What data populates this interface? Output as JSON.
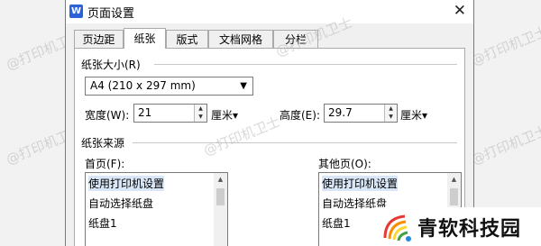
{
  "window": {
    "title": "页面设置",
    "close_icon": "✕"
  },
  "tabs": [
    {
      "label": "页边距",
      "active": false
    },
    {
      "label": "纸张",
      "active": true
    },
    {
      "label": "版式",
      "active": false
    },
    {
      "label": "文档网格",
      "active": false
    },
    {
      "label": "分栏",
      "active": false
    }
  ],
  "paper_size": {
    "section_label": "纸张大小(R)",
    "selected": "A4 (210 x 297 mm)",
    "width_label": "宽度(W):",
    "width_value": "21",
    "width_unit": "厘米▾",
    "height_label": "高度(E):",
    "height_value": "29.7",
    "height_unit": "厘米▾"
  },
  "paper_source": {
    "section_label": "纸张来源",
    "first_page_label": "首页(F):",
    "first_page_items": [
      "使用打印机设置",
      "自动选择纸盘",
      "纸盘1"
    ],
    "other_pages_label": "其他页(O):",
    "other_pages_items": [
      "使用打印机设置",
      "自动选择纸盘",
      "纸盘1"
    ]
  },
  "watermark": "@打印机卫士",
  "brand": {
    "text": "青软科技园"
  },
  "colors": {
    "accent": "#2b62d9",
    "selection": "#d9e6f7"
  }
}
